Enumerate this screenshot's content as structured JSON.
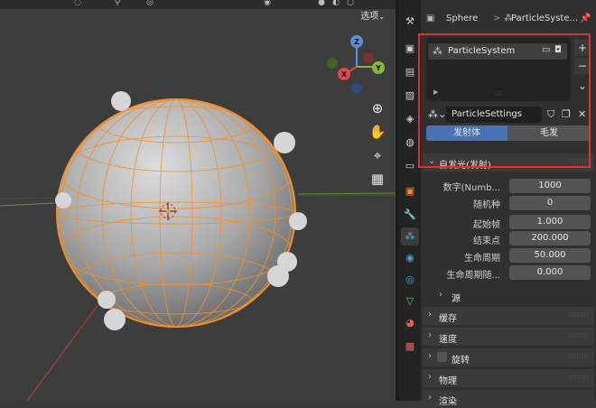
{
  "viewport": {
    "options_label": "选项",
    "gizmo": {
      "z": "Z",
      "x": "X",
      "y": "Y"
    }
  },
  "breadcrumb": {
    "object": "Sphere",
    "separator": ">",
    "particle_system": "ParticleSyste..."
  },
  "particle_list": {
    "item_label": "ParticleSystem",
    "add": "+",
    "remove": "−",
    "more": "⌄"
  },
  "settings": {
    "name": "ParticleSettings"
  },
  "type_segments": {
    "emitter": "发射体",
    "hair": "毛发",
    "active": "emitter"
  },
  "emission": {
    "header": "自发光(发射)",
    "fields": [
      {
        "label": "数字(Numb...",
        "value": "1000",
        "dot": false
      },
      {
        "label": "随机种",
        "value": "0",
        "dot": true
      },
      {
        "label": "起始帧",
        "value": "1.000",
        "dot": false
      },
      {
        "label": "结束点",
        "value": "200.000",
        "dot": false
      },
      {
        "label": "生命周期",
        "value": "50.000",
        "dot": true
      },
      {
        "label": "生命周期随...",
        "value": "0.000",
        "dot": true
      }
    ],
    "source_label": "源"
  },
  "panels": [
    {
      "label": "缓存"
    },
    {
      "label": "速度"
    },
    {
      "label": "旋转",
      "checkbox": true
    },
    {
      "label": "物理"
    },
    {
      "label": "渲染"
    }
  ],
  "colors": {
    "accent": "#4772b3",
    "highlight": "#e03030",
    "selection": "#f0902a"
  }
}
